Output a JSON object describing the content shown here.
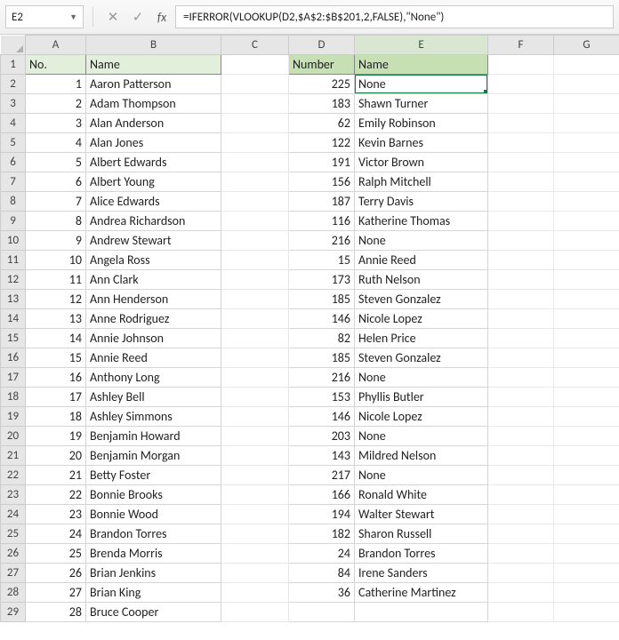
{
  "nameBox": "E2",
  "formula": "=IFERROR(VLOOKUP(D2,$A$2:$B$201,2,FALSE),\"None\")",
  "columns": [
    "A",
    "B",
    "C",
    "D",
    "E",
    "F",
    "G"
  ],
  "activeCols": [
    "E"
  ],
  "selectedCell": {
    "row": 2,
    "col": "E"
  },
  "header1": {
    "colA": "No.",
    "colB": "Name"
  },
  "header2": {
    "colD": "Number",
    "colE": "Name"
  },
  "rows": [
    {
      "r": 2,
      "a": 1,
      "b": "Aaron Patterson",
      "d": 225,
      "e": "None"
    },
    {
      "r": 3,
      "a": 2,
      "b": "Adam Thompson",
      "d": 183,
      "e": " Shawn Turner"
    },
    {
      "r": 4,
      "a": 3,
      "b": "Alan Anderson",
      "d": 62,
      "e": " Emily Robinson"
    },
    {
      "r": 5,
      "a": 4,
      "b": "Alan Jones",
      "d": 122,
      "e": " Kevin Barnes"
    },
    {
      "r": 6,
      "a": 5,
      "b": "Albert Edwards",
      "d": 191,
      "e": " Victor Brown"
    },
    {
      "r": 7,
      "a": 6,
      "b": "Albert Young",
      "d": 156,
      "e": " Ralph Mitchell"
    },
    {
      "r": 8,
      "a": 7,
      "b": "Alice Edwards",
      "d": 187,
      "e": " Terry Davis"
    },
    {
      "r": 9,
      "a": 8,
      "b": "Andrea Richardson",
      "d": 116,
      "e": " Katherine Thomas"
    },
    {
      "r": 10,
      "a": 9,
      "b": "Andrew Stewart",
      "d": 216,
      "e": "None"
    },
    {
      "r": 11,
      "a": 10,
      "b": "Angela Ross",
      "d": 15,
      "e": " Annie Reed"
    },
    {
      "r": 12,
      "a": 11,
      "b": "Ann Clark",
      "d": 173,
      "e": " Ruth Nelson"
    },
    {
      "r": 13,
      "a": 12,
      "b": "Ann Henderson",
      "d": 185,
      "e": " Steven Gonzalez"
    },
    {
      "r": 14,
      "a": 13,
      "b": "Anne Rodriguez",
      "d": 146,
      "e": " Nicole Lopez"
    },
    {
      "r": 15,
      "a": 14,
      "b": "Annie Johnson",
      "d": 82,
      "e": " Helen Price"
    },
    {
      "r": 16,
      "a": 15,
      "b": "Annie Reed",
      "d": 185,
      "e": " Steven Gonzalez"
    },
    {
      "r": 17,
      "a": 16,
      "b": "Anthony Long",
      "d": 216,
      "e": "None"
    },
    {
      "r": 18,
      "a": 17,
      "b": "Ashley Bell",
      "d": 153,
      "e": " Phyllis Butler"
    },
    {
      "r": 19,
      "a": 18,
      "b": "Ashley Simmons",
      "d": 146,
      "e": " Nicole Lopez"
    },
    {
      "r": 20,
      "a": 19,
      "b": "Benjamin Howard",
      "d": 203,
      "e": "None"
    },
    {
      "r": 21,
      "a": 20,
      "b": "Benjamin Morgan",
      "d": 143,
      "e": " Mildred Nelson"
    },
    {
      "r": 22,
      "a": 21,
      "b": "Betty Foster",
      "d": 217,
      "e": "None"
    },
    {
      "r": 23,
      "a": 22,
      "b": "Bonnie Brooks",
      "d": 166,
      "e": " Ronald White"
    },
    {
      "r": 24,
      "a": 23,
      "b": "Bonnie Wood",
      "d": 194,
      "e": " Walter Stewart"
    },
    {
      "r": 25,
      "a": 24,
      "b": "Brandon Torres",
      "d": 182,
      "e": " Sharon Russell"
    },
    {
      "r": 26,
      "a": 25,
      "b": "Brenda Morris",
      "d": 24,
      "e": " Brandon Torres"
    },
    {
      "r": 27,
      "a": 26,
      "b": "Brian Jenkins",
      "d": 84,
      "e": " Irene Sanders"
    },
    {
      "r": 28,
      "a": 27,
      "b": "Brian King",
      "d": 36,
      "e": " Catherine Martinez"
    },
    {
      "r": 29,
      "a": 28,
      "b": "Bruce Cooper",
      "d": "",
      "e": ""
    }
  ]
}
